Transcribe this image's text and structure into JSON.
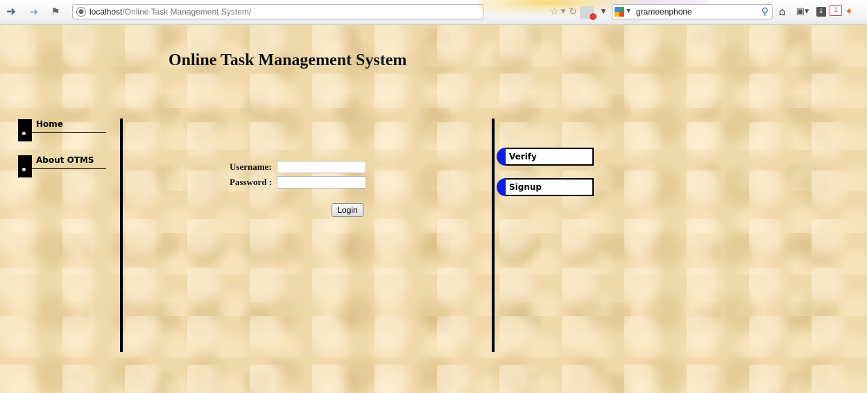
{
  "browser": {
    "url_host": "localhost",
    "url_path": "/Online Task Management System/",
    "search_query": "grameenphone",
    "badge_count": "1",
    "icons": [
      "back-arrow-icon",
      "forward-arrow-icon",
      "bookmark-icon",
      "globe-icon",
      "star-icon",
      "reload-icon",
      "addon-icon",
      "google-icon",
      "search-icon",
      "home-icon",
      "bookmarks-menu-icon",
      "download-icon",
      "notification-icon",
      "extension-icon"
    ]
  },
  "page": {
    "title": "Online Task Management System",
    "background_color": "#efd9ab"
  },
  "left_nav": {
    "items": [
      {
        "label": "Home"
      },
      {
        "label": "About OTMS"
      }
    ]
  },
  "login_form": {
    "username_label": "Username:",
    "password_label": "Password :",
    "username_value": "",
    "password_value": "",
    "login_label": "Login"
  },
  "right_nav": {
    "accent_color": "#0a1ee0",
    "items": [
      {
        "label": "Verify"
      },
      {
        "label": "Signup"
      }
    ]
  }
}
